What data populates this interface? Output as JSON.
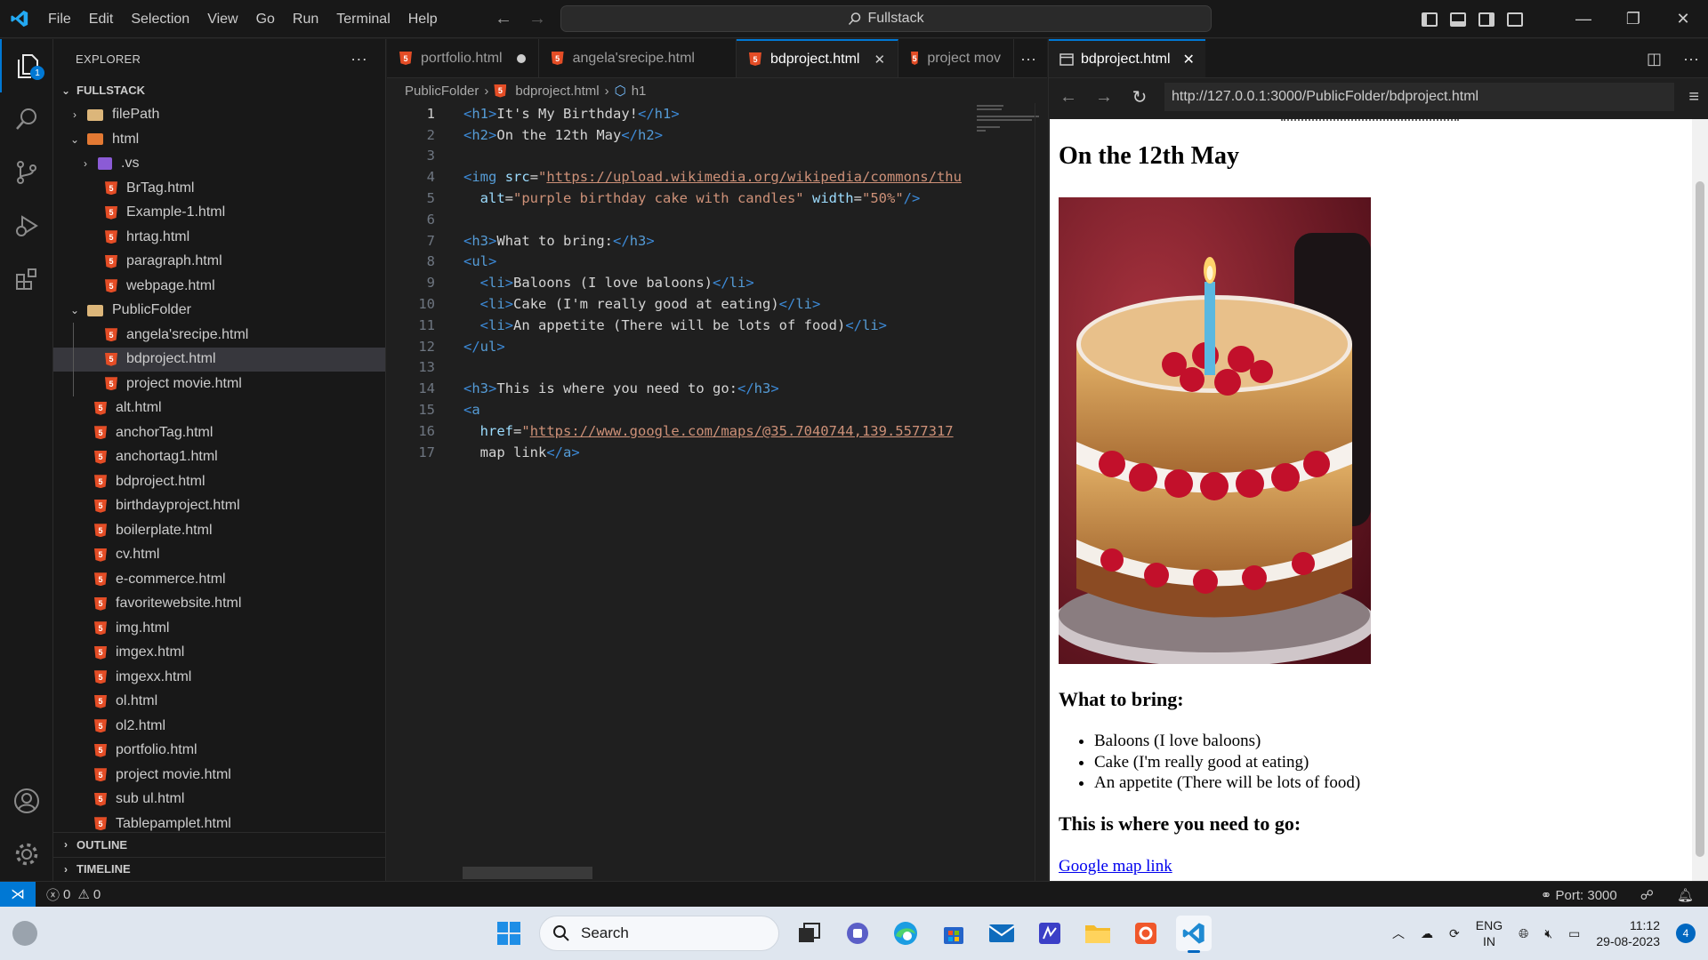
{
  "titlebar": {
    "menu": [
      "File",
      "Edit",
      "Selection",
      "View",
      "Go",
      "Run",
      "Terminal",
      "Help"
    ],
    "command_center": "Fullstack"
  },
  "activity": {
    "explorer_badge": "1"
  },
  "sidebar": {
    "title": "EXPLORER",
    "more": "···",
    "root": "FULLSTACK",
    "items": [
      {
        "label": "filePath",
        "kind": "folder",
        "depth": 1,
        "chevron": "closed"
      },
      {
        "label": "html",
        "kind": "folder-html",
        "depth": 1,
        "chevron": "open"
      },
      {
        "label": ".vs",
        "kind": "vs",
        "depth": 2,
        "chevron": "closed"
      },
      {
        "label": "BrTag.html",
        "kind": "html",
        "depth": 2
      },
      {
        "label": "Example-1.html",
        "kind": "html",
        "depth": 2
      },
      {
        "label": "hrtag.html",
        "kind": "html",
        "depth": 2
      },
      {
        "label": "paragraph.html",
        "kind": "html",
        "depth": 2
      },
      {
        "label": "webpage.html",
        "kind": "html",
        "depth": 2
      },
      {
        "label": "PublicFolder",
        "kind": "folder",
        "depth": 1,
        "chevron": "open"
      },
      {
        "label": "angela'srecipe.html",
        "kind": "html",
        "depth": 2
      },
      {
        "label": "bdproject.html",
        "kind": "html",
        "depth": 2,
        "selected": true
      },
      {
        "label": "project movie.html",
        "kind": "html",
        "depth": 2
      },
      {
        "label": "alt.html",
        "kind": "html",
        "depth": 1
      },
      {
        "label": "anchorTag.html",
        "kind": "html",
        "depth": 1
      },
      {
        "label": "anchortag1.html",
        "kind": "html",
        "depth": 1
      },
      {
        "label": "bdproject.html",
        "kind": "html",
        "depth": 1
      },
      {
        "label": "birthdayproject.html",
        "kind": "html",
        "depth": 1
      },
      {
        "label": "boilerplate.html",
        "kind": "html",
        "depth": 1
      },
      {
        "label": "cv.html",
        "kind": "html",
        "depth": 1
      },
      {
        "label": "e-commerce.html",
        "kind": "html",
        "depth": 1
      },
      {
        "label": "favoritewebsite.html",
        "kind": "html",
        "depth": 1
      },
      {
        "label": "img.html",
        "kind": "html",
        "depth": 1
      },
      {
        "label": "imgex.html",
        "kind": "html",
        "depth": 1
      },
      {
        "label": "imgexx.html",
        "kind": "html",
        "depth": 1
      },
      {
        "label": "ol.html",
        "kind": "html",
        "depth": 1
      },
      {
        "label": "ol2.html",
        "kind": "html",
        "depth": 1
      },
      {
        "label": "portfolio.html",
        "kind": "html",
        "depth": 1
      },
      {
        "label": "project movie.html",
        "kind": "html",
        "depth": 1
      },
      {
        "label": "sub ul.html",
        "kind": "html",
        "depth": 1
      },
      {
        "label": "Tablepamplet.html",
        "kind": "html",
        "depth": 1
      }
    ],
    "outline": "OUTLINE",
    "timeline": "TIMELINE"
  },
  "editor": {
    "tabs": [
      {
        "label": "portfolio.html",
        "state": "dirty"
      },
      {
        "label": "angela'srecipe.html",
        "state": "normal"
      },
      {
        "label": "bdproject.html",
        "state": "active"
      },
      {
        "label": "project mov",
        "state": "normal"
      }
    ],
    "tabs_more": "···",
    "breadcrumb": [
      "PublicFolder",
      "bdproject.html",
      "h1"
    ],
    "lines": [
      {
        "n": "1",
        "html": "<span class='tk-tag'>&lt;</span><span class='tk-name'>h1</span><span class='tk-tag'>&gt;</span><span class='tk-text'>It's My Birthday!</span><span class='tk-tag'>&lt;/</span><span class='tk-name'>h1</span><span class='tk-tag'>&gt;</span>"
      },
      {
        "n": "2",
        "html": "<span class='tk-tag'>&lt;</span><span class='tk-name'>h2</span><span class='tk-tag'>&gt;</span><span class='tk-text'>On the 12th May</span><span class='tk-tag'>&lt;/</span><span class='tk-name'>h2</span><span class='tk-tag'>&gt;</span>"
      },
      {
        "n": "3",
        "html": ""
      },
      {
        "n": "4",
        "html": "<span class='tk-tag'>&lt;</span><span class='tk-name'>img</span> <span class='tk-attr'>src</span><span class='tk-text'>=</span><span class='tk-str'>\"</span><span class='tk-url'>https://upload.wikimedia.org/wikipedia/commons/thu</span>"
      },
      {
        "n": "5",
        "html": "  <span class='tk-attr'>alt</span><span class='tk-text'>=</span><span class='tk-str'>\"purple birthday cake with candles\"</span> <span class='tk-attr'>width</span><span class='tk-text'>=</span><span class='tk-str'>\"50%\"</span><span class='tk-tag'>/&gt;</span>"
      },
      {
        "n": "6",
        "html": ""
      },
      {
        "n": "7",
        "html": "<span class='tk-tag'>&lt;</span><span class='tk-name'>h3</span><span class='tk-tag'>&gt;</span><span class='tk-text'>What to bring:</span><span class='tk-tag'>&lt;/</span><span class='tk-name'>h3</span><span class='tk-tag'>&gt;</span>"
      },
      {
        "n": "8",
        "html": "<span class='tk-tag'>&lt;</span><span class='tk-name'>ul</span><span class='tk-tag'>&gt;</span>"
      },
      {
        "n": "9",
        "html": "  <span class='tk-tag'>&lt;</span><span class='tk-name'>li</span><span class='tk-tag'>&gt;</span><span class='tk-text'>Baloons (I love baloons)</span><span class='tk-tag'>&lt;/</span><span class='tk-name'>li</span><span class='tk-tag'>&gt;</span>"
      },
      {
        "n": "10",
        "html": "  <span class='tk-tag'>&lt;</span><span class='tk-name'>li</span><span class='tk-tag'>&gt;</span><span class='tk-text'>Cake (I'm really good at eating)</span><span class='tk-tag'>&lt;/</span><span class='tk-name'>li</span><span class='tk-tag'>&gt;</span>"
      },
      {
        "n": "11",
        "html": "  <span class='tk-tag'>&lt;</span><span class='tk-name'>li</span><span class='tk-tag'>&gt;</span><span class='tk-text'>An appetite (There will be lots of food)</span><span class='tk-tag'>&lt;/</span><span class='tk-name'>li</span><span class='tk-tag'>&gt;</span>"
      },
      {
        "n": "12",
        "html": "<span class='tk-tag'>&lt;/</span><span class='tk-name'>ul</span><span class='tk-tag'>&gt;</span>"
      },
      {
        "n": "13",
        "html": ""
      },
      {
        "n": "14",
        "html": "<span class='tk-tag'>&lt;</span><span class='tk-name'>h3</span><span class='tk-tag'>&gt;</span><span class='tk-text'>This is where you need to go:</span><span class='tk-tag'>&lt;/</span><span class='tk-name'>h3</span><span class='tk-tag'>&gt;</span>"
      },
      {
        "n": "15",
        "html": "<span class='tk-tag'>&lt;</span><span class='tk-name'>a</span>"
      },
      {
        "n": "16",
        "html": "  <span class='tk-attr'>href</span><span class='tk-text'>=</span><span class='tk-str'>\"</span><span class='tk-url'>https://www.google.com/maps/@35.7040744,139.5577317</span>"
      },
      {
        "n": "17",
        "html": "  <span class='tk-text'>map link</span><span class='tk-tag'>&lt;/</span><span class='tk-name'>a</span><span class='tk-tag'>&gt;</span>"
      }
    ]
  },
  "preview": {
    "tab_label": "bdproject.html",
    "url": "http://127.0.0.1:3000/PublicFolder/bdproject.html",
    "page": {
      "h2": "On the 12th May",
      "h3_bring": "What to bring:",
      "list": [
        "Baloons (I love baloons)",
        "Cake (I'm really good at eating)",
        "An appetite (There will be lots of food)"
      ],
      "h3_go": "This is where you need to go:",
      "link": "Google map link"
    }
  },
  "statusbar": {
    "errors": "0",
    "warnings": "0",
    "port": "Port: 3000"
  },
  "taskbar": {
    "search_placeholder": "Search",
    "lang_top": "ENG",
    "lang_bottom": "IN",
    "time": "11:12",
    "date": "29-08-2023",
    "notifications": "4"
  }
}
